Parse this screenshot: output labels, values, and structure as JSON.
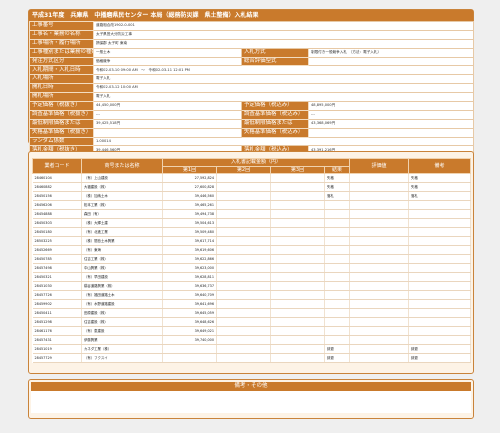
{
  "header": {
    "title": "平成31年度　兵庫県　中播磨県民センター 本局（総務防災課　県土整備）入札結果",
    "rows": [
      {
        "l1": "工事番号",
        "v1": "道路相合改1902-0-001"
      },
      {
        "l1": "工事名・業務の名称",
        "v1": "太子県営大分防災工事"
      },
      {
        "l1": "工事場所・履行場所",
        "v1": "揖保郡 太子町 東南"
      },
      {
        "l1": "工事種別または業務の種類",
        "v1": "一般土木",
        "l2": "入札方式",
        "v2": "制限付き一般競争入札　（方法：電子入札）"
      },
      {
        "l1": "発注方式区分",
        "v1": "価格競争",
        "l2": "総合評価型式",
        "v2": ""
      },
      {
        "l1": "入札期間・入札日時",
        "v1": "令和02-03-10 09:00 AM　〜　令和02-03-11 12:01 PM"
      },
      {
        "l1": "入札場所",
        "v1": "電子入札"
      },
      {
        "l1": "開札日時",
        "v1": "令和02-03-12 10:00 AM"
      },
      {
        "l1": "開札場所",
        "v1": "電子入札"
      },
      {
        "l1": "予定価格（税抜き）",
        "v1": "44,450,000円",
        "l2": "予定価格（税込み）",
        "v2": "48,895,000円"
      },
      {
        "l1": "調査基準価格（税抜き）",
        "v1": "---",
        "l2": "調査基準価格（税込み）",
        "v2": "---"
      },
      {
        "l1": "最低制限価格または",
        "v1": "39,425,518円",
        "l2": "最低制限価格または",
        "v2": "43,368,069円"
      },
      {
        "l1": "失格基準価格（税抜き）",
        "v1": "",
        "l2": "失格基準価格（税込み）",
        "v2": ""
      },
      {
        "l1": "ランダム係数",
        "v1": "1.00014"
      },
      {
        "l1": "落札金額（税抜き）",
        "v1": "39,446,560円",
        "l2": "落札金額（税込み）",
        "v2": "43,391,216円"
      }
    ]
  },
  "results": {
    "headers": {
      "code": "業者コード",
      "name": "商号または名称",
      "amount_group": "入札書記載金額（円）",
      "r1": "第1回",
      "r2": "第2回",
      "r3": "第3回",
      "result": "結果",
      "eval": "評価値",
      "note": "備考"
    },
    "rows": [
      {
        "code": "28460104",
        "name": "（有）上山建設",
        "r1": "27,592,824",
        "result": "失格",
        "note": "失格"
      },
      {
        "code": "28460882",
        "name": "大福建設（株）",
        "r1": "27,600,828",
        "result": "失格",
        "note": "失格"
      },
      {
        "code": "28450156",
        "name": "（株）加納土木",
        "r1": "39,446,560",
        "result": "落札",
        "note": "落札"
      },
      {
        "code": "28456206",
        "name": "松本工業（株）",
        "r1": "39,465,261",
        "result": "",
        "note": ""
      },
      {
        "code": "28454888",
        "name": "森田（有）",
        "r1": "39,494,738",
        "result": "",
        "note": ""
      },
      {
        "code": "28450303",
        "name": "（株）大輝土建",
        "r1": "39,504,613",
        "result": "",
        "note": ""
      },
      {
        "code": "28450180",
        "name": "（有）北進工業",
        "r1": "39,509,480",
        "result": "",
        "note": ""
      },
      {
        "code": "28503225",
        "name": "（株）間島土木興業",
        "r1": "39,617,714",
        "result": "",
        "note": ""
      },
      {
        "code": "28452669",
        "name": "（有）東海",
        "r1": "39,619,606",
        "result": "",
        "note": ""
      },
      {
        "code": "28450785",
        "name": "住吉工業（株）",
        "r1": "39,622,866",
        "result": "",
        "note": ""
      },
      {
        "code": "28457498",
        "name": "中山興業（株）",
        "r1": "39,623,000",
        "result": "",
        "note": ""
      },
      {
        "code": "28450321",
        "name": "（有）早田建設",
        "r1": "39,628,811",
        "result": "",
        "note": ""
      },
      {
        "code": "28451030",
        "name": "橋谷道路興業（株）",
        "r1": "39,636,737",
        "result": "",
        "note": ""
      },
      {
        "code": "28457726",
        "name": "（有）福田道路土木",
        "r1": "39,640,709",
        "result": "",
        "note": ""
      },
      {
        "code": "28459902",
        "name": "（有）水野道路建設",
        "r1": "39,641,696",
        "result": "",
        "note": ""
      },
      {
        "code": "28450411",
        "name": "田原建設（株）",
        "r1": "39,645,059",
        "result": "",
        "note": ""
      },
      {
        "code": "28451298",
        "name": "住吉建設（株）",
        "r1": "39,648,626",
        "result": "",
        "note": ""
      },
      {
        "code": "28461176",
        "name": "（有）恵建設",
        "r1": "39,649,021",
        "result": "",
        "note": ""
      },
      {
        "code": "28457431",
        "name": "伊藤興業",
        "r1": "39,740,000",
        "result": "",
        "note": ""
      },
      {
        "code": "28451019",
        "name": "カネダ工業（株）",
        "r1": "",
        "result": "辞退",
        "note": "辞退"
      },
      {
        "code": "28457729",
        "name": "（有）フクスイ",
        "r1": "",
        "result": "辞退",
        "note": "辞退"
      }
    ]
  },
  "remarks": {
    "title": "備考・その他",
    "body": ""
  },
  "colors": {
    "accent": "#c97a2c",
    "panel": "#fdf3e6",
    "border": "#c9833a"
  }
}
